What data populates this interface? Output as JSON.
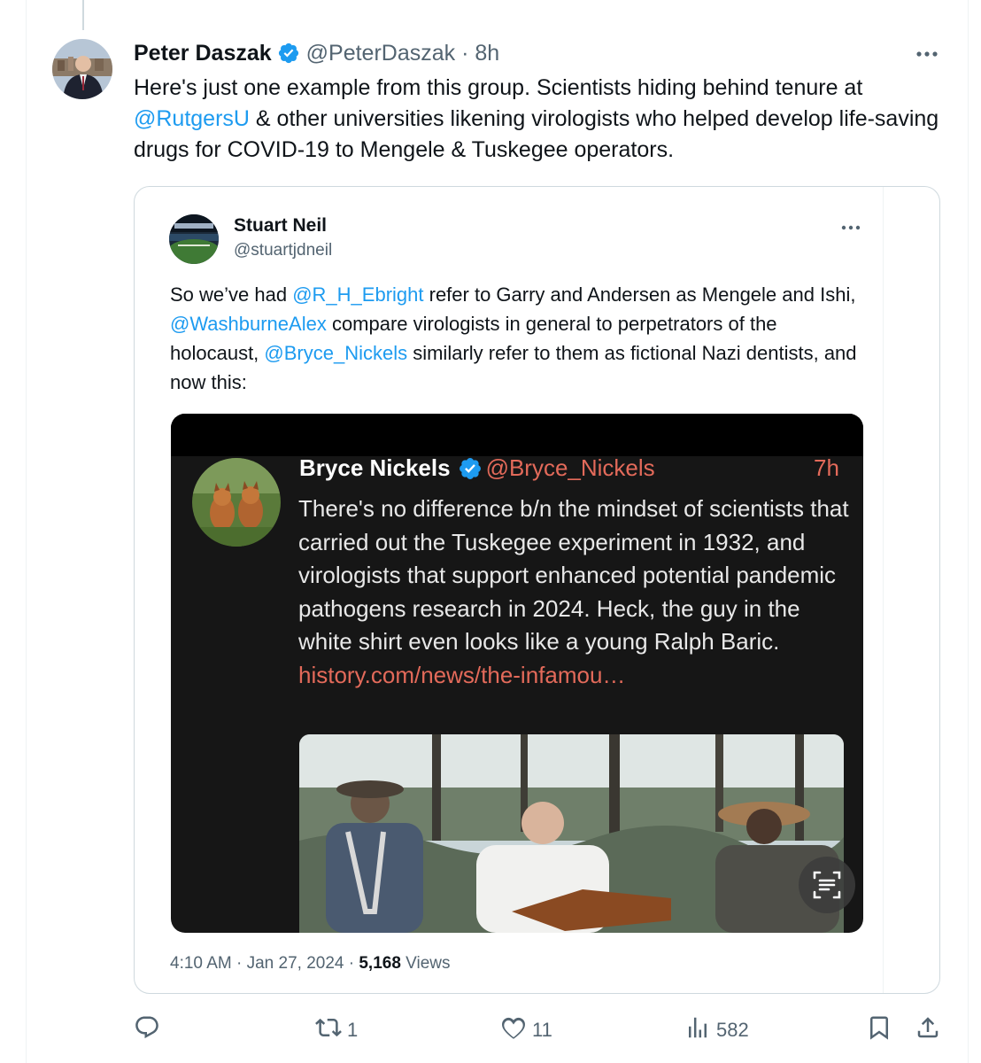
{
  "tweet": {
    "author_name": "Peter Daszak",
    "author_handle": "@PeterDaszak",
    "separator": "·",
    "time": "8h",
    "text_before_mention": "Here's just one example from this group. Scientists hiding behind tenure at ",
    "mention": "@RutgersU",
    "text_after_mention": " & other universities likening virologists who helped develop life-saving drugs for COVID-19 to Mengele & Tuskegee operators."
  },
  "quoted": {
    "author_name": "Stuart Neil",
    "author_handle": "@stuartjdneil",
    "text_1": "So we’ve had ",
    "mention_1": "@R_H_Ebright",
    "text_2": " refer to Garry and Andersen as Mengele and Ishi, ",
    "mention_2": "@WashburneAlex",
    "text_3": " compare virologists in general to perpetrators of the holocaust, ",
    "mention_3": "@Bryce_Nickels",
    "text_4": " similarly refer to them as fictional Nazi dentists, and now this:",
    "footer_time": "4:10 AM · Jan 27, 2024 · ",
    "views_count": "5,168",
    "views_label": " Views"
  },
  "screenshot": {
    "author_name": "Bryce Nickels",
    "author_handle": "@Bryce_Nickels",
    "time": "7h",
    "text": "There's no difference b/n the mindset of scientists that carried out the Tuskegee experiment in 1932, and virologists that support enhanced potential pandemic pathogens research in 2024. Heck, the guy in the white shirt even looks like a young Ralph Baric.",
    "link": "history.com/news/the-infamou…"
  },
  "actions": {
    "reply_count": "",
    "retweet_count": "1",
    "like_count": "11",
    "views_count": "582"
  },
  "colors": {
    "link_blue": "#1d9bf0",
    "secondary_text": "#536471",
    "screenshot_accent": "#e36a5a",
    "border": "#cfd9de"
  },
  "icons": [
    "verified-badge-icon",
    "more-icon",
    "reply-icon",
    "retweet-icon",
    "like-icon",
    "views-icon",
    "bookmark-icon",
    "share-icon",
    "text-scan-icon"
  ]
}
